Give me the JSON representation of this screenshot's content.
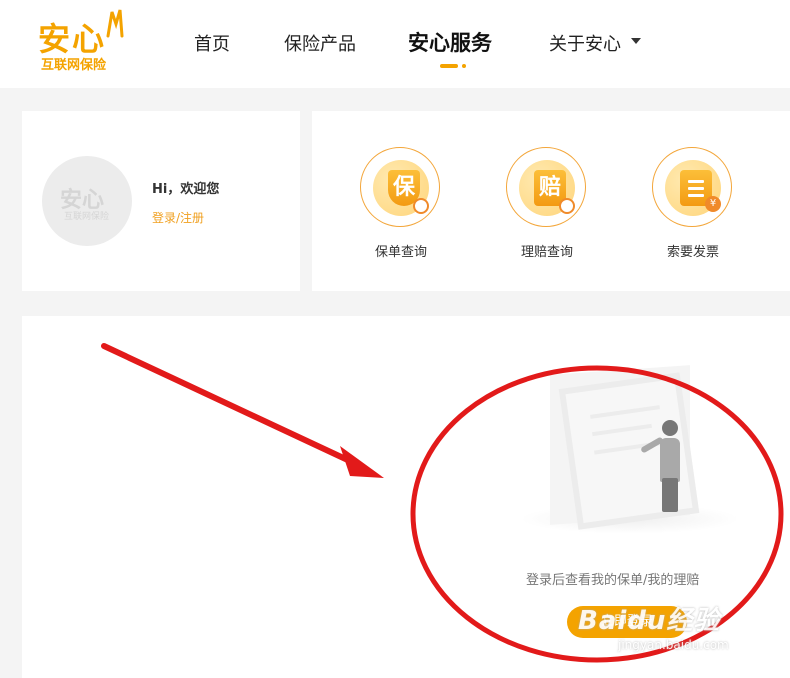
{
  "logo": {
    "main": "安心",
    "sub": "互联网保险"
  },
  "nav": {
    "items": [
      {
        "label": "首页"
      },
      {
        "label": "保险产品"
      },
      {
        "label": "安心服务"
      },
      {
        "label": "关于安心"
      }
    ],
    "active_index": 2
  },
  "user": {
    "avatar_main": "安心",
    "avatar_sub": "互联网保险",
    "greeting": "Hi，欢迎您",
    "login_link": "登录/注册"
  },
  "services": [
    {
      "label": "保单查询",
      "icon": "policy-shield-icon",
      "glyph": "保"
    },
    {
      "label": "理赔查询",
      "icon": "claim-clipboard-icon",
      "glyph": "赔"
    },
    {
      "label": "索要发票",
      "icon": "invoice-clipboard-icon",
      "glyph": "¥"
    }
  ],
  "empty_state": {
    "message": "登录后查看我的保单/我的理赔",
    "button_label": "立即登录"
  },
  "watermark": {
    "main": "Baidu经验",
    "sub": "jingyan.baidu.com"
  },
  "colors": {
    "brand": "#f4a300",
    "annotation": "#e21a1a"
  }
}
